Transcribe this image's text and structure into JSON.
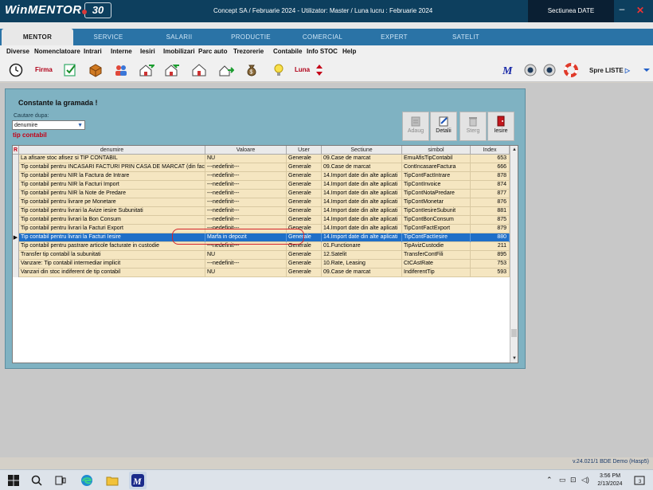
{
  "app": {
    "logo": "WinMENTOR",
    "logo_badge": "30",
    "window_title": "Concept SA / Februarie 2024 - Utilizator: Master / Luna lucru : Februarie 2024",
    "data_section": "Sectiunea DATE",
    "minimize_label": "–",
    "close_label": "✕"
  },
  "module_tabs": [
    "MENTOR",
    "SERVICE",
    "SALARII",
    "PRODUCTIE",
    "COMERCIAL",
    "EXPERT",
    "SATELIT"
  ],
  "menu": [
    "Diverse",
    "Nomenclatoare",
    "Intrari",
    "Interne",
    "Iesiri",
    "Imobilizari",
    "Parc auto",
    "Trezorerie",
    "Contabile",
    "Info STOC",
    "Help"
  ],
  "toolbar": {
    "firma_label": "Firma",
    "luna_label": "Luna",
    "spre_liste_label": "Spre LISTE"
  },
  "form": {
    "title": "Constante la gramada !",
    "search_label": "Cautare dupa:",
    "search_field": "denumire",
    "search_value": "tip contabil",
    "buttons": {
      "adaug": "Adaug",
      "detalii": "Detalii",
      "sterg": "Sterg",
      "iesire": "Iesire"
    }
  },
  "grid": {
    "row_marker": "R",
    "columns": [
      "denumire",
      "Valoare",
      "User",
      "Sectiune",
      "simbol",
      "Index"
    ],
    "rows": [
      {
        "denumire": "La afisare stoc afisez si TIP CONTABIL",
        "valoare": "NU",
        "user": "Generale",
        "sectiune": "09.Case de marcat",
        "simbol": "EmuAfisTipContabil",
        "index": "653"
      },
      {
        "denumire": "Tip contabil pentru INCASARI FACTURI PRIN CASA DE MARCAT (din factu...",
        "valoare": "---nedefinit---",
        "user": "Generale",
        "sectiune": "09.Case de marcat",
        "simbol": "ContIncasareFactura",
        "index": "666"
      },
      {
        "denumire": "Tip contabil pentru NIR la Factura de Intrare",
        "valoare": "---nedefinit---",
        "user": "Generale",
        "sectiune": "14.Import date din alte aplicati",
        "simbol": "TipContFactIntrare",
        "index": "878"
      },
      {
        "denumire": "Tip contabil pentru NIR la Facturi Import",
        "valoare": "---nedefinit---",
        "user": "Generale",
        "sectiune": "14.Import date din alte aplicati",
        "simbol": "TipContInvoice",
        "index": "874"
      },
      {
        "denumire": "Tip contabil pentru NIR la Note de Predare",
        "valoare": "---nedefinit---",
        "user": "Generale",
        "sectiune": "14.Import date din alte aplicati",
        "simbol": "TipContNotaPredare",
        "index": "877"
      },
      {
        "denumire": "Tip contabil pentru livrare pe Monetare",
        "valoare": "---nedefinit---",
        "user": "Generale",
        "sectiune": "14.Import date din alte aplicati",
        "simbol": "TipContMonetar",
        "index": "876"
      },
      {
        "denumire": "Tip contabil pentru livrari la Avize iesire Subunitati",
        "valoare": "---nedefinit---",
        "user": "Generale",
        "sectiune": "14.Import date din alte aplicati",
        "simbol": "TipContIesireSubunit",
        "index": "881"
      },
      {
        "denumire": "Tip contabil pentru livrari la Bon Consum",
        "valoare": "---nedefinit---",
        "user": "Generale",
        "sectiune": "14.Import date din alte aplicati",
        "simbol": "TipContBonConsum",
        "index": "875"
      },
      {
        "denumire": "Tip contabil pentru livrari la Facturi Export",
        "valoare": "---nedefinit---",
        "user": "Generale",
        "sectiune": "14.Import date din alte aplicati",
        "simbol": "TipContFactExport",
        "index": "879"
      },
      {
        "denumire": "Tip contabil pentru livrari la Facturi Iesire",
        "valoare": "Marfa in depozit",
        "user": "Generale",
        "sectiune": "14.Import date din alte aplicati",
        "simbol": "TipContFactIesire",
        "index": "880",
        "selected": true
      },
      {
        "denumire": "Tip contabil pentru pastrare articole facturate in custodie",
        "valoare": "---nedefinit---",
        "user": "Generale",
        "sectiune": "01.Functionare",
        "simbol": "TipAvizCustodie",
        "index": "211"
      },
      {
        "denumire": "Transfer tip contabil la subunitati",
        "valoare": "NU",
        "user": "Generale",
        "sectiune": "12.Satelit",
        "simbol": "TransferContFili",
        "index": "895"
      },
      {
        "denumire": "Vanzare: Tip contabil intermediar implicit",
        "valoare": "---nedefinit---",
        "user": "Generale",
        "sectiune": "10.Rate, Leasing",
        "simbol": "CtCAstRate",
        "index": "753"
      },
      {
        "denumire": "Vanzari din stoc indiferent de tip contabil",
        "valoare": "NU",
        "user": "Generale",
        "sectiune": "09.Case de marcat",
        "simbol": "IndiferentTip",
        "index": "593"
      }
    ]
  },
  "status": {
    "version": "v.24.021/1 BDE  Demo (Hasp5)"
  },
  "taskbar": {
    "time": "3:56 PM",
    "date": "2/13/2024",
    "notif_count": "3"
  },
  "colors": {
    "titlebar": "#0d3f5e",
    "tabbar": "#2a73a6",
    "form_bg": "#7fb2c2",
    "row_bg": "#f5e6c1",
    "row_selected": "#1f6fc8",
    "accent_red": "#c40016"
  }
}
